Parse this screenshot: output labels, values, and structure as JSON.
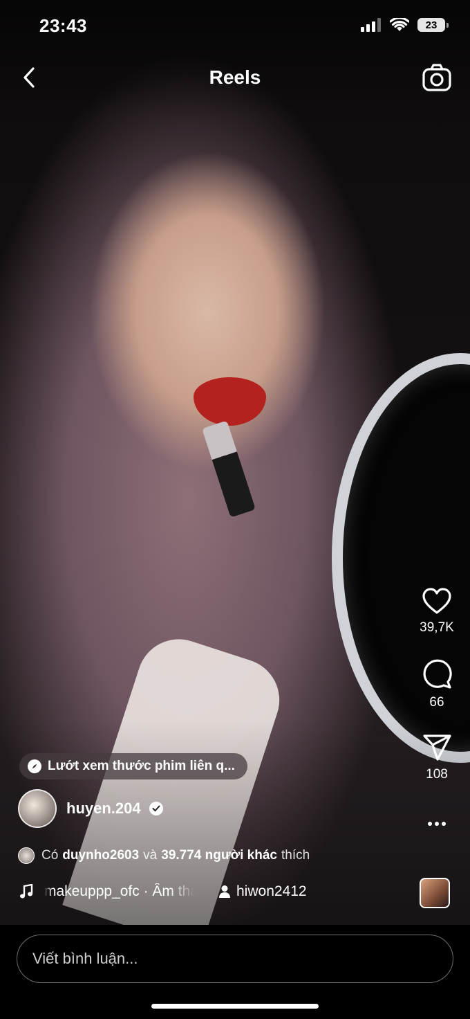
{
  "status_bar": {
    "time": "23:43",
    "battery": "23"
  },
  "header": {
    "title": "Reels"
  },
  "actions": {
    "likes": "39,7K",
    "comments": "66",
    "shares": "108"
  },
  "related": {
    "label": "Lướt xem thước phim liên q..."
  },
  "post": {
    "username": "huyen.204",
    "likes_prefix": "Có",
    "liker": "duynho2603",
    "likes_joiner": "và",
    "likes_others": "39.774 người khác",
    "likes_suffix": "thích"
  },
  "audio": {
    "track": "makeuppp_ofc · Âm thanh gốc",
    "tagged_user": "hiwon2412"
  },
  "comment": {
    "placeholder": "Viết bình luận..."
  }
}
